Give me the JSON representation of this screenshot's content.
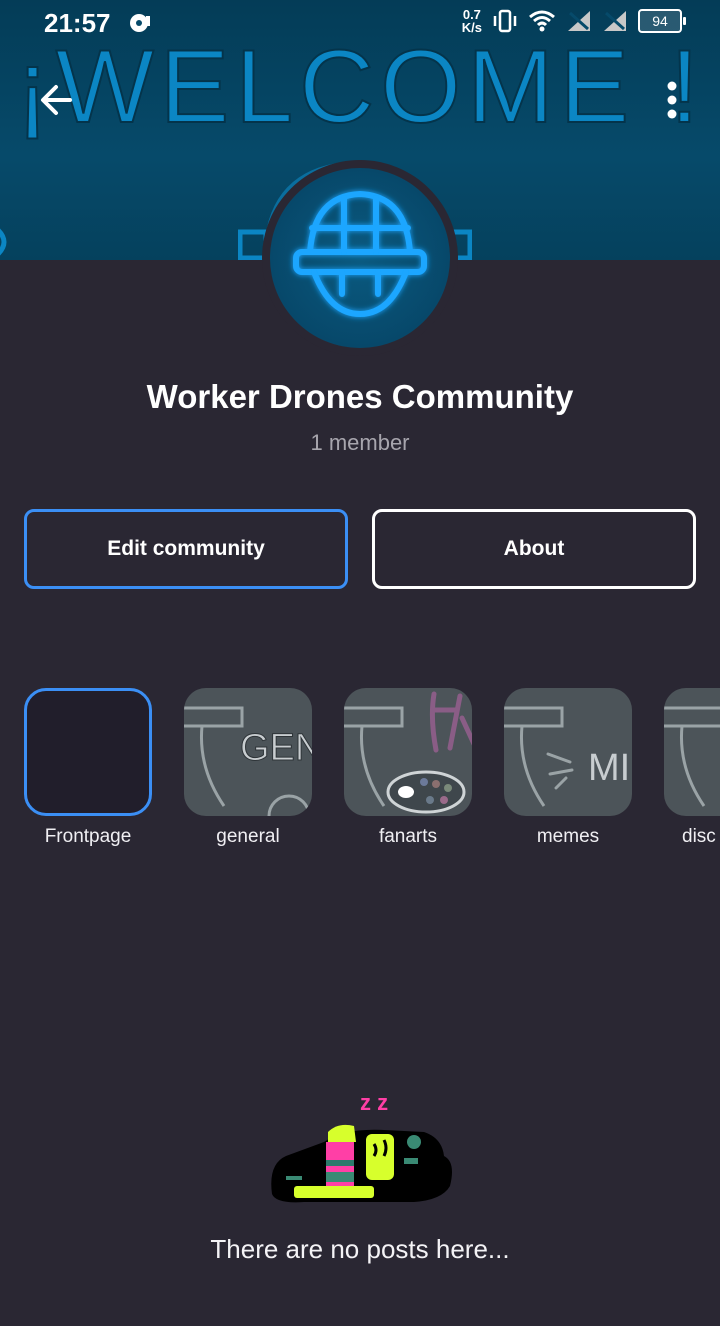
{
  "status_bar": {
    "time": "21:57",
    "net_speed_value": "0.7",
    "net_speed_unit": "K/s",
    "battery": "94",
    "icons": [
      "media-icon",
      "vibrate-icon",
      "wifi-icon",
      "no-sim-icon",
      "no-sim-icon",
      "battery-icon"
    ]
  },
  "banner": {
    "text": "¡WELCOME !"
  },
  "header": {
    "back_icon": "back-arrow-icon",
    "menu_icon": "more-vertical-icon"
  },
  "community": {
    "name": "Worker Drones Community",
    "members": "1 member"
  },
  "actions": {
    "edit_label": "Edit community",
    "about_label": "About"
  },
  "channels": [
    {
      "label": "Frontpage",
      "selected": true,
      "thumb_text": ""
    },
    {
      "label": "general",
      "selected": false,
      "thumb_text": "GEN"
    },
    {
      "label": "fanarts",
      "selected": false,
      "thumb_text": ""
    },
    {
      "label": "memes",
      "selected": false,
      "thumb_text": "MI"
    },
    {
      "label": "disc",
      "selected": false,
      "thumb_text": ""
    }
  ],
  "empty_state": {
    "text": "There are no posts here...",
    "illustration": "sleeping-drone-illustration",
    "zz": "z z"
  },
  "colors": {
    "background": "#2a2733",
    "accent": "#3b8ff5",
    "banner": "#064a6a",
    "neon": "#1aa6ff"
  }
}
